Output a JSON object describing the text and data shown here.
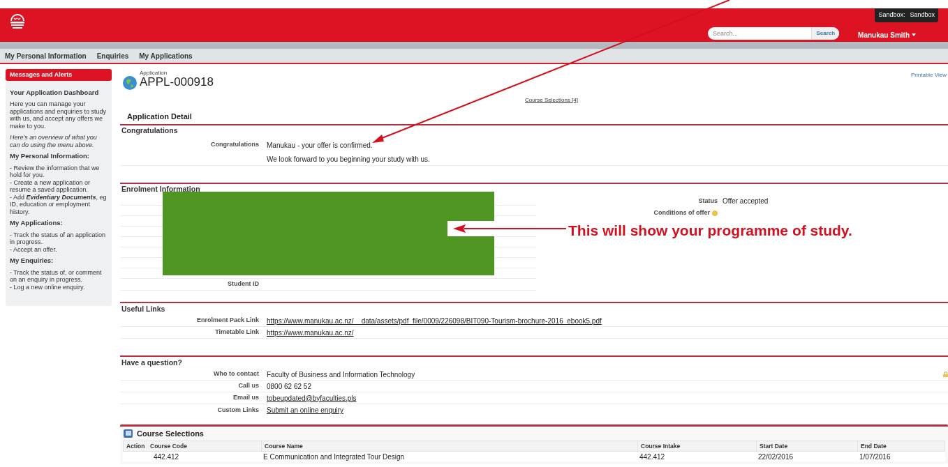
{
  "header": {
    "sandbox_label": "Sandbox:",
    "sandbox_value": "Sandbox",
    "search_placeholder": "Search...",
    "search_button": "Search",
    "user": "Manukau Smith"
  },
  "nav": [
    {
      "label": "My Personal Information",
      "selected": false
    },
    {
      "label": "Enquiries",
      "selected": false
    },
    {
      "label": "My Applications",
      "selected": false
    }
  ],
  "sidebar": {
    "title": "Messages and Alerts",
    "heading": "Your Application Dashboard",
    "intro": "Here you can manage your applications and enquiries to study with us, and accept any offers we make to you.",
    "overview": "Here's an overview of what you can do using the menu above.",
    "groups": [
      {
        "title": "My Personal Information:",
        "items": [
          "- Review the information that we hold for you.",
          "- Create a new application or resume a saved application.",
          "- Add **Evidentiary Documents**, eg ID, education or employment history."
        ]
      },
      {
        "title": "My Applications:",
        "items": [
          "- Track the status of an application in progress.",
          "- Accept an offer."
        ]
      },
      {
        "title": "My Enquiries:",
        "items": [
          "- Track the status of, or comment on an enquiry in progress.",
          "- Log a new online enquiry."
        ]
      }
    ]
  },
  "record": {
    "type": "Application",
    "name": "APPL-000918",
    "printable": "Printable View",
    "related_link": "Course Selections",
    "related_count": "[4]",
    "detail_title": "Application Detail"
  },
  "congratulations": {
    "title": "Congratulations",
    "label": "Congratulations",
    "lines": [
      "Manukau - your offer is confirmed.",
      "We look forward to you beginning your study with us."
    ]
  },
  "enrolment": {
    "title": "Enrolment Information",
    "right_fields": [
      {
        "label": "Status",
        "value": "Offer accepted",
        "kind": "text"
      },
      {
        "label": "Conditions of offer",
        "kind": "help"
      }
    ],
    "student_id_label": "Student ID"
  },
  "useful_links": {
    "title": "Useful Links",
    "rows": [
      {
        "label": "Enrolment Pack Link",
        "value": "https://www.manukau.ac.nz/__data/assets/pdf_file/0009/226098/BIT090-Tourism-brochure-2016_ebook5.pdf",
        "kind": "link"
      },
      {
        "label": "Timetable Link",
        "value": "https://www.manukau.ac.nz/",
        "kind": "link"
      }
    ]
  },
  "question": {
    "title": "Have a question?",
    "rows": [
      {
        "label": "Who to contact",
        "value": "Faculty of Business and Information Technology",
        "kind": "text"
      },
      {
        "label": "Call us",
        "value": "0800 62 62 52",
        "kind": "text"
      },
      {
        "label": "Email us",
        "value": "tobeupdated@byfaculties.pls",
        "kind": "link"
      },
      {
        "label": "Custom Links",
        "value": "Submit an online enquiry",
        "kind": "link"
      }
    ]
  },
  "course_selections": {
    "title": "Course Selections",
    "columns": [
      "Action",
      "Course Code",
      "Course Name",
      "Course Intake",
      "Start Date",
      "End Date"
    ],
    "rows": [
      {
        "code": "442.412",
        "name": "E Communication and Integrated Tour Design",
        "intake": "442.412",
        "start": "22/02/2016",
        "end": "1/07/2016"
      }
    ]
  },
  "annotation": {
    "callout": "This will show your programme of study."
  }
}
